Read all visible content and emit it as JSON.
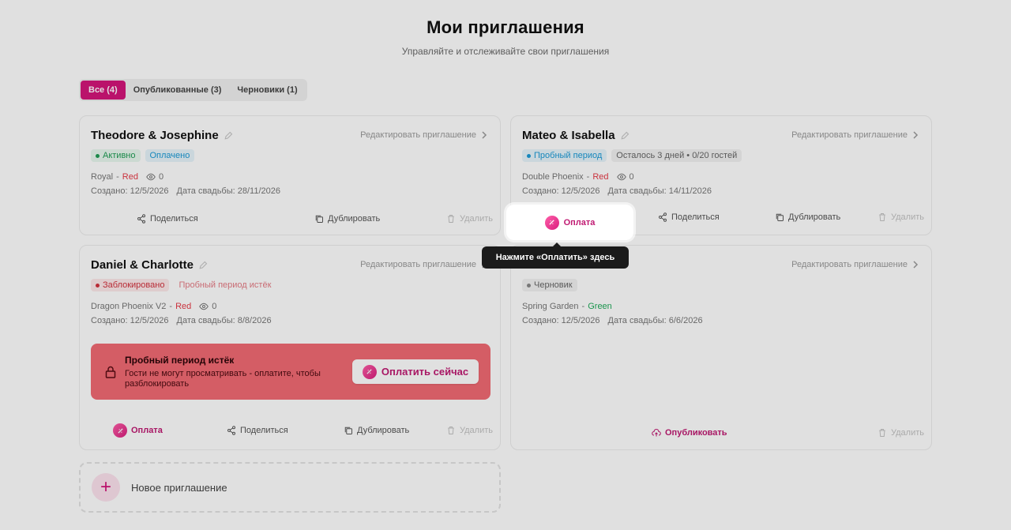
{
  "header": {
    "title": "Мои приглашения",
    "subtitle": "Управляйте и отслеживайте свои приглашения"
  },
  "tabs": [
    {
      "label": "Все (4)",
      "active": true
    },
    {
      "label": "Опубликованные (3)",
      "active": false
    },
    {
      "label": "Черновики (1)",
      "active": false
    }
  ],
  "common": {
    "edit": "Редактировать приглашение",
    "share": "Поделиться",
    "duplicate": "Дублировать",
    "delete": "Удалить",
    "pay": "Оплата",
    "publish": "Опубликовать"
  },
  "cards": [
    {
      "name": "Theodore & Josephine",
      "badge1": "Активно",
      "badge2": "Оплачено",
      "theme": "Royal",
      "color": "Red",
      "views": "0",
      "created": "Создано: 12/5/2026",
      "wedding": "Дата свадьбы: 28/11/2026"
    },
    {
      "name": "Mateo & Isabella",
      "badge1": "Пробный период",
      "badge2": "Осталось 3 дней • 0/20 гостей",
      "theme": "Double Phoenix",
      "color": "Red",
      "views": "0",
      "created": "Создано: 12/5/2026",
      "wedding": "Дата свадьбы: 14/11/2026"
    },
    {
      "name": "Daniel & Charlotte",
      "badge1": "Заблокировано",
      "badge2": "Пробный период истёк",
      "theme": "Dragon Phoenix V2",
      "color": "Red",
      "views": "0",
      "created": "Создано: 12/5/2026",
      "wedding": "Дата свадьбы: 8/8/2026",
      "expired_title": "Пробный период истёк",
      "expired_text": "Гости не могут просматривать - оплатите, чтобы разблокировать",
      "pay_now": "Оплатить сейчас"
    },
    {
      "badge1": "Черновик",
      "theme": "Spring Garden",
      "color": "Green",
      "created": "Создано: 12/5/2026",
      "wedding": "Дата свадьбы: 6/6/2026"
    }
  ],
  "new_invitation": "Новое приглашение",
  "spotlight": {
    "label": "Оплата"
  },
  "tooltip": "Нажмите «Оплатить» здесь",
  "colors": {
    "accent": "#d4157a",
    "success": "#1f9d55",
    "info": "#1a9ad6",
    "danger": "#e63946"
  }
}
